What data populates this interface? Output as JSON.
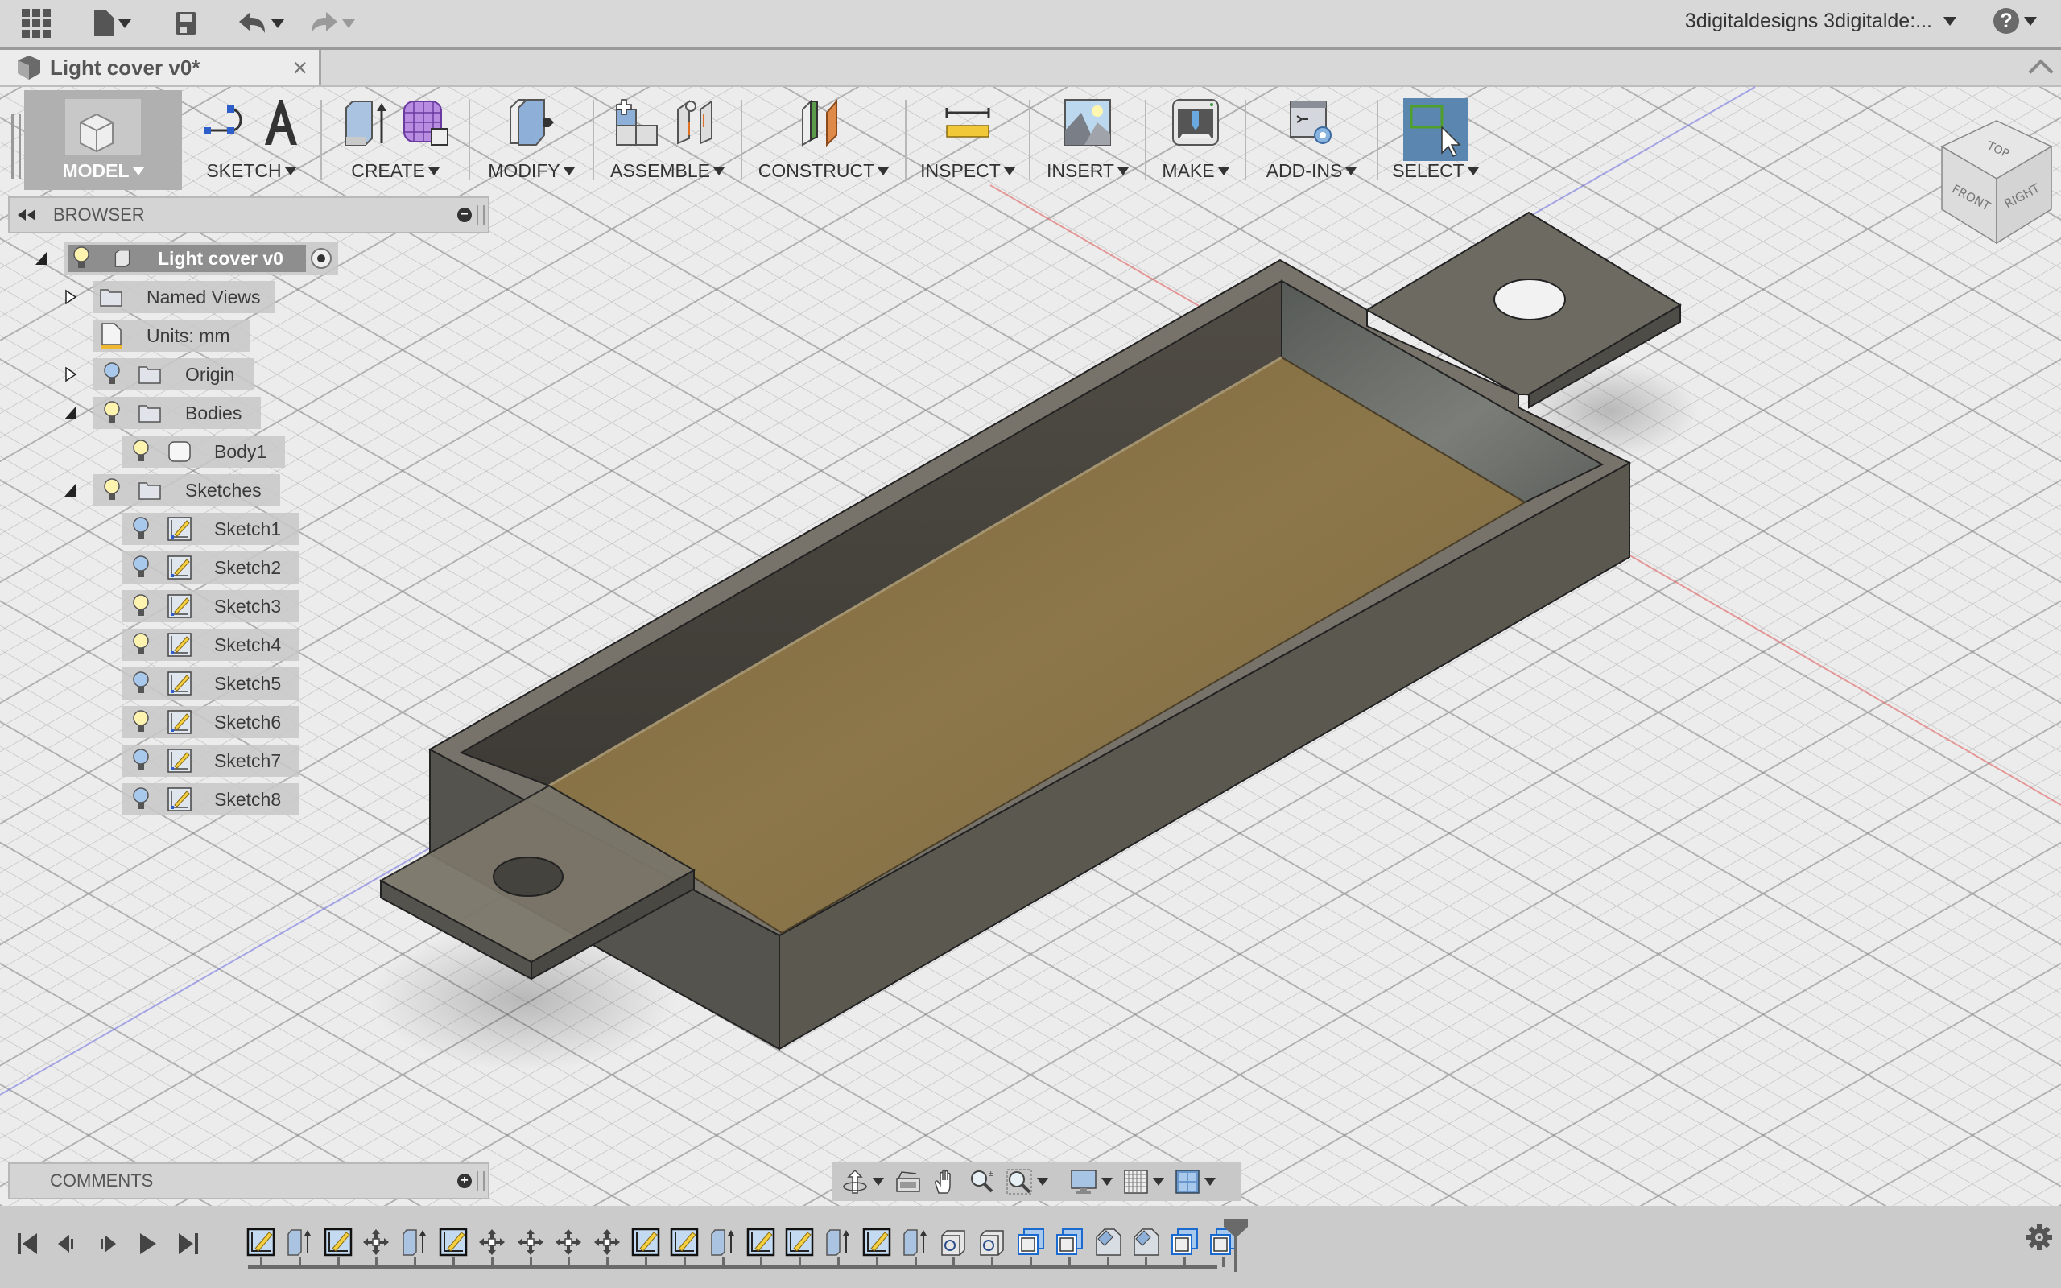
{
  "app": {
    "toolbar": {
      "grid_icon": "app-grid-icon",
      "file_icon": "file-icon",
      "save_icon": "save-icon",
      "undo_icon": "undo-icon",
      "redo_icon": "redo-icon"
    },
    "user_menu": "3digitaldesigns 3digitalde:...",
    "help_label": "?"
  },
  "document_tab": {
    "title": "Light cover v0*",
    "close": "×"
  },
  "ribbon": {
    "workspace": "MODEL",
    "groups": [
      {
        "label": "SKETCH"
      },
      {
        "label": "CREATE"
      },
      {
        "label": "MODIFY"
      },
      {
        "label": "ASSEMBLE"
      },
      {
        "label": "CONSTRUCT"
      },
      {
        "label": "INSPECT"
      },
      {
        "label": "INSERT"
      },
      {
        "label": "MAKE"
      },
      {
        "label": "ADD-INS"
      },
      {
        "label": "SELECT"
      }
    ]
  },
  "browser": {
    "title": "BROWSER",
    "root": {
      "label": "Light cover v0",
      "visible": true
    },
    "items": [
      {
        "label": "Named Views",
        "type": "folder",
        "expanded": false
      },
      {
        "label": "Units: mm",
        "type": "units"
      },
      {
        "label": "Origin",
        "type": "folder",
        "expanded": false,
        "visible": false
      },
      {
        "label": "Bodies",
        "type": "folder",
        "expanded": true,
        "visible": true
      },
      {
        "label": "Body1",
        "type": "body",
        "visible": true
      },
      {
        "label": "Sketches",
        "type": "folder",
        "expanded": true,
        "visible": true
      }
    ],
    "sketches": [
      {
        "label": "Sketch1",
        "visible": false
      },
      {
        "label": "Sketch2",
        "visible": false
      },
      {
        "label": "Sketch3",
        "visible": true
      },
      {
        "label": "Sketch4",
        "visible": true
      },
      {
        "label": "Sketch5",
        "visible": false
      },
      {
        "label": "Sketch6",
        "visible": true
      },
      {
        "label": "Sketch7",
        "visible": false
      },
      {
        "label": "Sketch8",
        "visible": false
      }
    ]
  },
  "comments": {
    "title": "COMMENTS"
  },
  "viewcube": {
    "top": "TOP",
    "front": "FRONT",
    "right": "RIGHT"
  },
  "nav_toolbar": [
    "orbit",
    "look-at",
    "pan",
    "zoom",
    "fit",
    "display-settings",
    "grid-settings",
    "viewports"
  ],
  "timeline": {
    "features": [
      "sketch",
      "extrude",
      "sketch",
      "move",
      "extrude",
      "sketch",
      "move",
      "move",
      "move",
      "move",
      "sketch",
      "sketch",
      "extrude",
      "sketch",
      "sketch",
      "extrude",
      "sketch",
      "extrude",
      "hole",
      "hole",
      "shell",
      "shell",
      "chamfer",
      "chamfer",
      "shell",
      "shell"
    ]
  },
  "colors": {
    "accent_select": "#5a86b0",
    "body_floor": "#8a7548",
    "body_wall": "#6f6b62",
    "x_axis": "#e05050",
    "z_axis": "#5a5ae0"
  }
}
